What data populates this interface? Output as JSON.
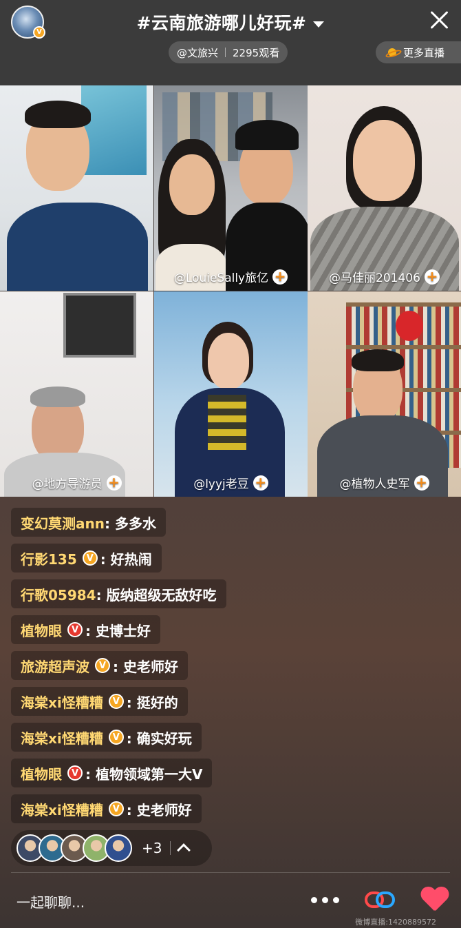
{
  "header": {
    "title": "#云南旅游哪儿好玩#",
    "host": "@文旅兴",
    "viewers": "2295观看",
    "more_live": "更多直播",
    "verify_mark": "V"
  },
  "tiles": [
    {
      "label": "",
      "show_follow": false
    },
    {
      "label": "@LouieSally旅亿",
      "show_follow": true
    },
    {
      "label": "@马佳丽201406",
      "show_follow": true
    },
    {
      "label": "@地方导游员",
      "show_follow": true
    },
    {
      "label": "@lyyj老豆",
      "show_follow": true
    },
    {
      "label": "@植物人史军",
      "show_follow": true
    }
  ],
  "follow_symbol": "+",
  "comments": [
    {
      "user": "变幻莫测ann",
      "badge": "",
      "text": ": 多多水"
    },
    {
      "user": "行影135",
      "badge": "gold",
      "text": ": 好热闹"
    },
    {
      "user": "行歌05984",
      "badge": "",
      "text": ": 版纳超级无敌好吃"
    },
    {
      "user": "植物眼",
      "badge": "red",
      "text": ": 史博士好"
    },
    {
      "user": "旅游超声波",
      "badge": "gold",
      "text": ": 史老师好"
    },
    {
      "user": "海棠xi怪糟糟",
      "badge": "gold",
      "text": ": 挺好的"
    },
    {
      "user": "海棠xi怪糟糟",
      "badge": "gold",
      "text": ": 确实好玩"
    },
    {
      "user": "植物眼",
      "badge": "red",
      "text": ": 植物领域第一大V"
    },
    {
      "user": "海棠xi怪糟糟",
      "badge": "gold",
      "text": ": 史老师好"
    }
  ],
  "badge_mark": "V",
  "viewer_bar": {
    "extra_count": "+3",
    "avatar_colors": [
      "#3d4a66",
      "#2e6b8f",
      "#6b5a4e",
      "#8fb36a",
      "#2f4f8f"
    ]
  },
  "bottom": {
    "chat_placeholder": "一起聊聊...",
    "watermark": "微博直播:1420889572"
  },
  "colors": {
    "username": "#ffd873",
    "accent_orange": "#f28c1b",
    "heart": "#ff4d6a"
  }
}
